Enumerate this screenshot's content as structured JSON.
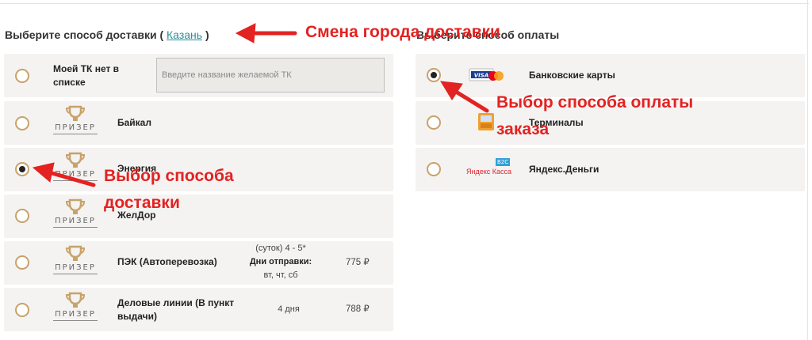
{
  "delivery": {
    "title_prefix": "Выберите способ доставки (",
    "city": "Казань",
    "title_suffix": ")",
    "custom_tk_label": "Моей ТК нет в списке",
    "custom_tk_placeholder": "Введите название желаемой ТК",
    "logo_word": "ПРИЗЕР",
    "options": [
      {
        "name": "Байкал",
        "selected": false
      },
      {
        "name": "Энергия",
        "selected": true
      },
      {
        "name": "ЖелДор",
        "selected": false
      },
      {
        "name": "ПЭК (Автоперевозка)",
        "term_line1": "(суток) 4 - 5*",
        "term_line2": "Дни отправки:",
        "term_line3": "вт, чт, сб",
        "price": "775 ₽",
        "selected": false
      },
      {
        "name": "Деловые линии (В пункт выдачи)",
        "term_line1": "4 дня",
        "price": "788 ₽",
        "selected": false
      }
    ]
  },
  "payment": {
    "title": "Выберите способ оплаты",
    "options": [
      {
        "name": "Банковские карты",
        "selected": true,
        "logo_text": "VISA"
      },
      {
        "name": "Терминалы",
        "selected": false
      },
      {
        "name": "Яндекс.Деньги",
        "selected": false,
        "logo_text": "Яндекс Касса",
        "logo_badge": "B2C"
      }
    ]
  },
  "annotations": {
    "city_change": "Смена города доставки",
    "payment_choice_line1": "Выбор способа оплаты",
    "payment_choice_line2": "заказа",
    "delivery_choice_line1": "Выбор способа",
    "delivery_choice_line2": "доставки"
  },
  "colors": {
    "accent": "#c8a26a",
    "link": "#2a8d9b",
    "annotation": "#e32222",
    "row_bg": "#f4f3f1"
  }
}
